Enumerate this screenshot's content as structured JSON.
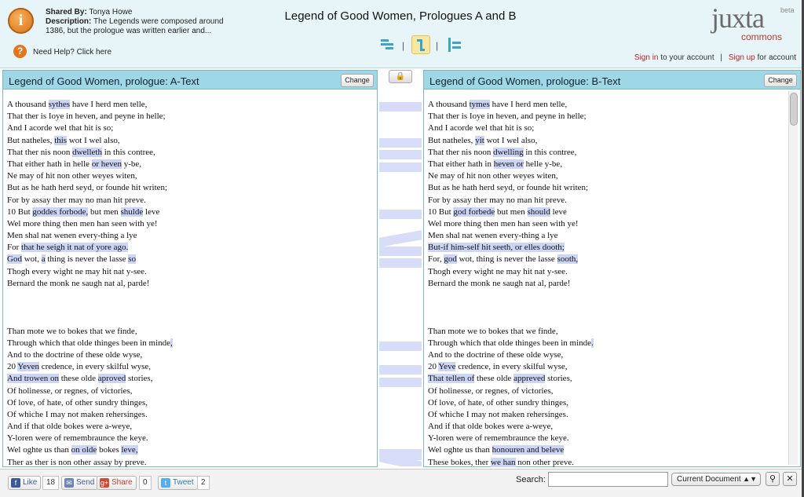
{
  "header": {
    "shared_by_label": "Shared By:",
    "shared_by": "Tonya Howe",
    "description_label": "Description:",
    "description": "The Legends were composed around 1386, but the prologue was written earlier and...",
    "help": "Need Help? Click here",
    "title": "Legend of Good Women, Prologues A and B",
    "logo": "juxta",
    "logo_beta": "beta",
    "logo_commons": "commons",
    "sign_in": "Sign in",
    "sign_in_suffix": "to your account",
    "sign_up": "Sign up",
    "sign_up_suffix": "for account",
    "separator": "|"
  },
  "paneA": {
    "title": "Legend of Good Women, prologue: A-Text",
    "change": "Change",
    "lines": [
      [
        {
          "t": "A thousand "
        },
        {
          "t": "sythes",
          "h": 1
        },
        {
          "t": " have I herd men telle,"
        }
      ],
      [
        {
          "t": "That ther is Ioye in heven, and peyne in helle;"
        }
      ],
      [
        {
          "t": "And I acorde wel that hit is so;"
        }
      ],
      [
        {
          "t": "But natheles, "
        },
        {
          "t": "this",
          "h": 1
        },
        {
          "t": " wot I wel also,"
        }
      ],
      [
        {
          "t": "That ther nis noon "
        },
        {
          "t": "dwelleth",
          "h": 1
        },
        {
          "t": " in this contree,"
        }
      ],
      [
        {
          "t": "That either hath in helle "
        },
        {
          "t": "or heven",
          "h": 1
        },
        {
          "t": " y-be,"
        }
      ],
      [
        {
          "t": "Ne may of hit non other weyes witen,"
        }
      ],
      [
        {
          "t": "But as he hath herd seyd, or founde hit writen;"
        }
      ],
      [
        {
          "t": "For by assay ther may no man hit preve."
        }
      ],
      [
        {
          "t": "10 But "
        },
        {
          "t": "goddes forbode,",
          "h": 1
        },
        {
          "t": " but men "
        },
        {
          "t": "shulde",
          "h": 1
        },
        {
          "t": " leve"
        }
      ],
      [
        {
          "t": "Wel more thing then men han seen with ye!"
        }
      ],
      [
        {
          "t": "Men shal nat wenen every-thing a lye"
        }
      ],
      [
        {
          "t": "For "
        },
        {
          "t": "that he seigh it nat of yore ago.",
          "h": 1
        }
      ],
      [
        {
          "t": "God",
          "h": 1
        },
        {
          "t": " wot, "
        },
        {
          "t": "a",
          "h": 1
        },
        {
          "t": " thing is never the lasse "
        },
        {
          "t": "so",
          "h": 1
        }
      ],
      [
        {
          "t": "Thogh every wight ne may hit nat y-see."
        }
      ],
      [
        {
          "t": "Bernard the monk ne saugh nat al, parde!"
        }
      ],
      [],
      [
        {
          "t": "Than mote we to bokes that we finde,"
        }
      ],
      [
        {
          "t": "Through which that olde thinges been in minde"
        },
        {
          "t": ",",
          "h": 1
        }
      ],
      [
        {
          "t": "And to the doctrine of these olde wyse,"
        }
      ],
      [
        {
          "t": "20 "
        },
        {
          "t": "Yeven",
          "h": 1
        },
        {
          "t": " credence, in every skilful wyse,"
        }
      ],
      [
        {
          "t": "And trowen on",
          "h": 1
        },
        {
          "t": " these olde "
        },
        {
          "t": "aproved",
          "h": 1
        },
        {
          "t": " stories,"
        }
      ],
      [
        {
          "t": "Of holinesse, or regnes, of victories,"
        }
      ],
      [
        {
          "t": "Of love, of hate, of other sundry thinges,"
        }
      ],
      [
        {
          "t": "Of whiche I may not maken rehersinges."
        }
      ],
      [
        {
          "t": "And if that olde bokes were a-weye,"
        }
      ],
      [
        {
          "t": "Y-loren were of remembraunce the keye."
        }
      ],
      [
        {
          "t": "Wel oghte us than "
        },
        {
          "t": "on olde",
          "h": 1
        },
        {
          "t": " bokes "
        },
        {
          "t": "leve,",
          "h": 1
        }
      ],
      [
        {
          "t": "Ther as ther is non other assay by preve."
        }
      ]
    ]
  },
  "paneB": {
    "title": "Legend of Good Women, prologue: B-Text",
    "change": "Change",
    "lines": [
      [
        {
          "t": "A thousand "
        },
        {
          "t": "tymes",
          "h": 1
        },
        {
          "t": " have I herd men telle,"
        }
      ],
      [
        {
          "t": "That ther is Ioye in heven, and peyne in helle;"
        }
      ],
      [
        {
          "t": "And I acorde wel that hit is so;"
        }
      ],
      [
        {
          "t": "But natheles, "
        },
        {
          "t": "yit",
          "h": 1
        },
        {
          "t": " wot I wel also,"
        }
      ],
      [
        {
          "t": "That ther nis noon "
        },
        {
          "t": "dwelling",
          "h": 1
        },
        {
          "t": " in this contree,"
        }
      ],
      [
        {
          "t": "That either hath in "
        },
        {
          "t": "heven or",
          "h": 1
        },
        {
          "t": " helle y-be,"
        }
      ],
      [
        {
          "t": "Ne may of hit non other weyes witen,"
        }
      ],
      [
        {
          "t": "But as he hath herd seyd, or founde hit writen;"
        }
      ],
      [
        {
          "t": "For by assay ther may no man hit preve."
        }
      ],
      [
        {
          "t": "10 But "
        },
        {
          "t": "god forbede",
          "h": 1
        },
        {
          "t": " but men "
        },
        {
          "t": "should",
          "h": 1
        },
        {
          "t": " leve"
        }
      ],
      [
        {
          "t": "Wel more thing then men han seen with ye!"
        }
      ],
      [
        {
          "t": "Men shal nat wenen every-thing a lye"
        }
      ],
      [
        {
          "t": "But-if him-self hit seeth, or elles dooth;",
          "h": 1
        }
      ],
      [
        {
          "t": "For, "
        },
        {
          "t": "god",
          "h": 1
        },
        {
          "t": " wot, thing is never the lasse "
        },
        {
          "t": "sooth,",
          "h": 1
        }
      ],
      [
        {
          "t": "Thogh every wight ne may hit nat y-see."
        }
      ],
      [
        {
          "t": "Bernard the monk ne saugh nat al, parde!"
        }
      ],
      [],
      [
        {
          "t": "Than mote we to bokes that we finde,"
        }
      ],
      [
        {
          "t": "Through which that olde thinges been in minde"
        },
        {
          "t": ".",
          "h": 1
        }
      ],
      [
        {
          "t": "And to the doctrine of these olde wyse,"
        }
      ],
      [
        {
          "t": "20 "
        },
        {
          "t": "Yeve",
          "h": 1
        },
        {
          "t": " credence, in every skilful wyse,"
        }
      ],
      [
        {
          "t": "That tellen of",
          "h": 1
        },
        {
          "t": " these olde "
        },
        {
          "t": "appreved",
          "h": 1
        },
        {
          "t": " stories,"
        }
      ],
      [
        {
          "t": "Of holinesse, or regnes, of victories,"
        }
      ],
      [
        {
          "t": "Of love, of hate, of other sundry thinges,"
        }
      ],
      [
        {
          "t": "Of whiche I may not maken rehersinges."
        }
      ],
      [
        {
          "t": "And if that olde bokes were a-weye,"
        }
      ],
      [
        {
          "t": "Y-loren were of remembraunce the keye."
        }
      ],
      [
        {
          "t": "Wel oghte us than "
        },
        {
          "t": "honouren and beleve",
          "h": 1
        }
      ],
      [
        {
          "t": "These bokes, ther "
        },
        {
          "t": "we han",
          "h": 1
        },
        {
          "t": " non other preve."
        }
      ]
    ]
  },
  "footer": {
    "like": "Like",
    "like_count": "18",
    "send": "Send",
    "share": "Share",
    "share_count": "0",
    "tweet": "Tweet",
    "tweet_count": "2",
    "search_label": "Search:",
    "search_value": "",
    "scope": "Current Document"
  },
  "colors": {
    "highlight": "#cdd5f7",
    "accent": "#9ed7e5",
    "link": "#b4232b"
  },
  "icons": [
    "info-icon",
    "help-icon",
    "side-by-side-icon",
    "collation-icon",
    "heat-map-icon",
    "lock-icon",
    "search-icon",
    "close-icon",
    "facebook-icon",
    "google-plus-icon",
    "twitter-icon"
  ]
}
